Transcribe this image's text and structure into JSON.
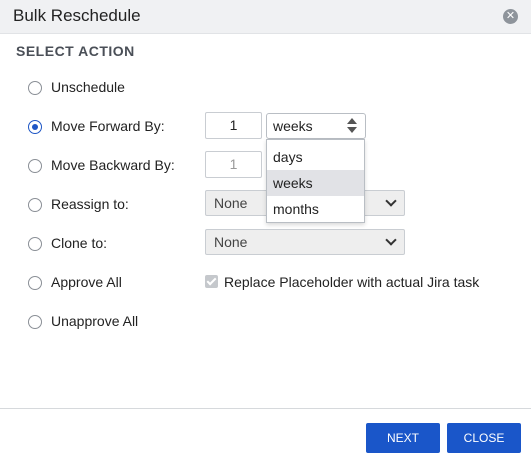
{
  "dialog": {
    "title": "Bulk Reschedule",
    "section_title": "SELECT ACTION"
  },
  "options": {
    "unschedule": "Unschedule",
    "move_forward": "Move Forward By:",
    "move_backward": "Move Backward By:",
    "reassign": "Reassign to:",
    "clone": "Clone to:",
    "approve_all": "Approve All",
    "unapprove_all": "Unapprove All",
    "selected": "move_forward"
  },
  "move_forward": {
    "value": "1",
    "unit": "weeks"
  },
  "move_backward": {
    "value": "1"
  },
  "unit_options": [
    "days",
    "weeks",
    "months"
  ],
  "unit_selected": "weeks",
  "reassign": {
    "value": "None"
  },
  "clone": {
    "value": "None"
  },
  "placeholder_checkbox": {
    "label": "Replace Placeholder with actual Jira task",
    "checked": true,
    "disabled": true
  },
  "buttons": {
    "next": "NEXT",
    "close": "CLOSE"
  },
  "colors": {
    "accent": "#1a56c9",
    "title_bar": "#f0f1f3"
  }
}
